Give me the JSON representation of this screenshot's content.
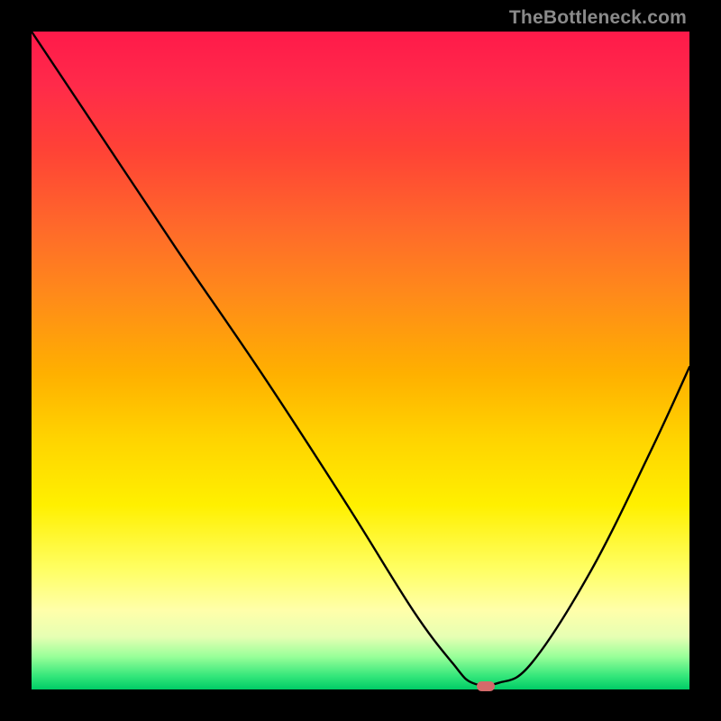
{
  "watermark": "TheBottleneck.com",
  "chart_data": {
    "type": "line",
    "title": "",
    "xlabel": "",
    "ylabel": "",
    "xlim": [
      0,
      100
    ],
    "ylim": [
      0,
      100
    ],
    "grid": false,
    "legend": false,
    "background_gradient": [
      "#ff1a4a",
      "#ff8a1a",
      "#fff000",
      "#ffffaa",
      "#00cc66"
    ],
    "series": [
      {
        "name": "bottleneck-curve",
        "x": [
          0,
          10,
          22,
          35,
          48,
          58,
          64,
          67,
          71,
          76,
          85,
          94,
          100
        ],
        "y": [
          100,
          85,
          67,
          48,
          28,
          12,
          4,
          1,
          1,
          4,
          18,
          36,
          49
        ]
      }
    ],
    "optimal_marker": {
      "x": 69,
      "y": 0.5,
      "color": "#d46a6a"
    }
  }
}
